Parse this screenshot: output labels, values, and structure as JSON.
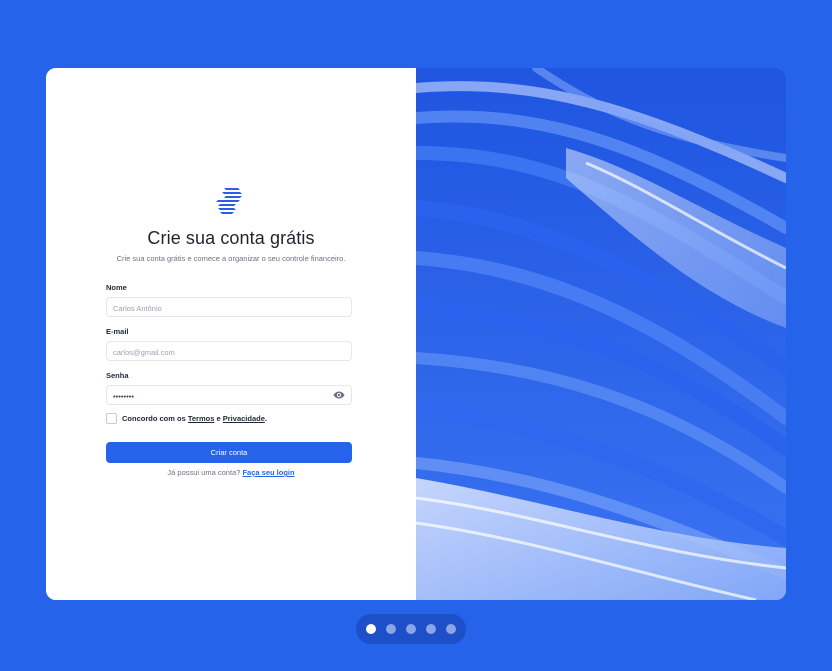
{
  "signup": {
    "title": "Crie sua conta grátis",
    "subtitle": "Crie sua conta grátis e comece a organizar o seu controle financeiro.",
    "name_label": "Nome",
    "name_placeholder": "Carlos Antônio",
    "email_label": "E-mail",
    "email_placeholder": "carlos@gmail.com",
    "password_label": "Senha",
    "password_value": "••••••••",
    "terms_prefix": "Concordo com os",
    "terms_link": "Termos",
    "terms_and": "e",
    "privacy_link": "Privacidade",
    "terms_suffix": ".",
    "submit_label": "Criar conta",
    "login_prompt": "Já possui uma conta?",
    "login_link": "Faça seu login"
  },
  "carousel": {
    "slide_count": 5,
    "active_index": 0
  },
  "colors": {
    "background": "#2563eb",
    "accent": "#2563eb"
  },
  "icons": {
    "logo": "brand-logo-icon",
    "password_toggle": "eye-icon"
  }
}
